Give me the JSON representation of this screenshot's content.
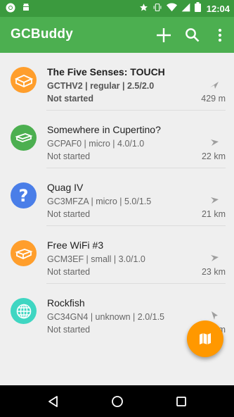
{
  "status_bar": {
    "time": "12:04",
    "icons": [
      "chrome-icon",
      "android-debug-icon",
      "star-icon",
      "vibrate-icon",
      "wifi-icon",
      "signal-icon",
      "battery-icon"
    ]
  },
  "app_bar": {
    "title": "GCBuddy",
    "actions": [
      "add-icon",
      "search-icon",
      "overflow-menu-icon"
    ]
  },
  "colors": {
    "app_bar": "#4caf50",
    "status_bar": "#3b9a3e",
    "fab": "#ff9800",
    "regular": "#ff9e2c",
    "micro": "#4caf50",
    "unknown": "#4a7ee8",
    "small": "#ff9e2c",
    "other": "#3fd6c2"
  },
  "caches": [
    {
      "title": "The Five Senses: TOUCH",
      "meta": "GCTHV2 | regular | 2.5/2.0",
      "status": "Not started",
      "distance": "429 m",
      "icon": "regular-cache-icon",
      "highlight": true
    },
    {
      "title": "Somewhere in Cupertino?",
      "meta": "GCPAF0 | micro | 4.0/1.0",
      "status": "Not started",
      "distance": "22 km",
      "icon": "micro-cache-icon",
      "highlight": false
    },
    {
      "title": "Quag IV",
      "meta": "GC3MFZA | micro | 5.0/1.5",
      "status": "Not started",
      "distance": "21 km",
      "icon": "unknown-cache-icon",
      "highlight": false
    },
    {
      "title": "Free WiFi #3",
      "meta": "GCM3EF | small | 3.0/1.0",
      "status": "Not started",
      "distance": "23 km",
      "icon": "small-cache-icon",
      "highlight": false
    },
    {
      "title": "Rockfish",
      "meta": "GC34GN4 | unknown | 2.0/1.5",
      "status": "Not started",
      "distance": "28 km",
      "icon": "earth-cache-icon",
      "highlight": false
    }
  ],
  "fab": {
    "icon": "map-icon"
  },
  "nav_bar": {
    "buttons": [
      "back-icon",
      "home-icon",
      "recents-icon"
    ]
  }
}
